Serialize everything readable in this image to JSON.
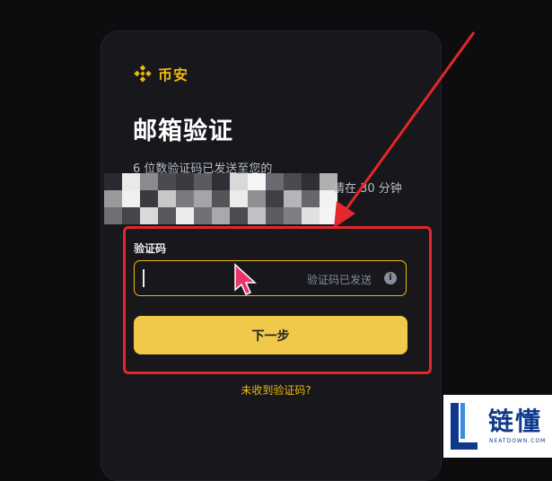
{
  "brand": {
    "name": "币安",
    "color": "#f0b90b"
  },
  "page": {
    "title": "邮箱验证",
    "description_line1": "6 位数验证码已发送至您的",
    "description_line2_tail": "请在 30 分钟"
  },
  "form": {
    "code_label": "验证码",
    "code_value": "",
    "code_status": "验证码已发送",
    "info_icon": "info-icon",
    "next_button": "下一步",
    "resend_link": "未收到验证码?"
  },
  "annotation": {
    "highlight_color": "#e5262a"
  },
  "watermark": {
    "name": "链懂",
    "domain": "NEATDOWN.COM"
  },
  "colors": {
    "accent": "#f0b90b",
    "button": "#f0c94a",
    "background": "#0d0d10",
    "card": "#17171c"
  }
}
